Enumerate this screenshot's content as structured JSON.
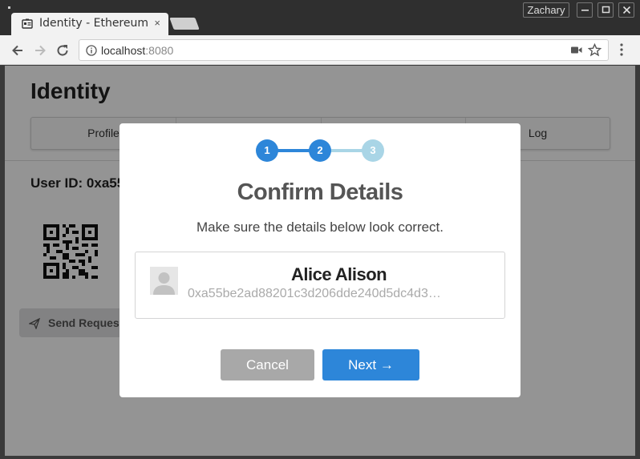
{
  "browser": {
    "tab_title": "Identity - Ethereum",
    "tab_close": "×",
    "user_name": "Zachary",
    "url_host": "localhost",
    "url_port": ":8080"
  },
  "page": {
    "title": "Identity",
    "menu": [
      {
        "label": "Profile"
      },
      {
        "label": ""
      },
      {
        "label": ""
      },
      {
        "label": "Log"
      }
    ],
    "user_id_label": "User ID: 0xa55",
    "send_request_label": "Send Request"
  },
  "modal": {
    "steps": [
      {
        "number": "1",
        "state": "complete"
      },
      {
        "number": "2",
        "state": "active"
      },
      {
        "number": "3",
        "state": "upcoming"
      }
    ],
    "title": "Confirm Details",
    "subtitle": "Make sure the details below look correct.",
    "contact": {
      "name": "Alice Alison",
      "address": "0xa55be2ad88201c3d206dde240d5dc4d3…"
    },
    "cancel_label": "Cancel",
    "next_label": "Next →"
  },
  "colors": {
    "step_complete": "#2d86d9",
    "step_upcoming": "#a9d5e6",
    "primary_button": "#2d86d9",
    "cancel_button": "#a8a8a8"
  }
}
